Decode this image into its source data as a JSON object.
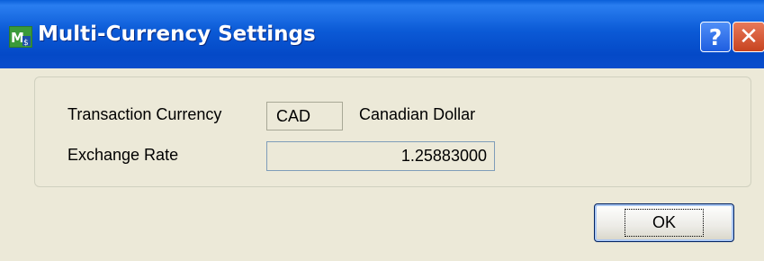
{
  "window": {
    "title": "Multi-Currency Settings",
    "icon": "app-logo-icon",
    "help_button_label": "?",
    "close_button_label": "✕"
  },
  "form": {
    "transaction_currency_label": "Transaction Currency",
    "currency_code": "CAD",
    "currency_name": "Canadian Dollar",
    "exchange_rate_label": "Exchange Rate",
    "exchange_rate_value": "1.25883000"
  },
  "buttons": {
    "ok_label": "OK"
  },
  "colors": {
    "titlebar": "#0b5ad6",
    "dialog_background": "#ece9d8",
    "close_button": "#c7431f"
  }
}
